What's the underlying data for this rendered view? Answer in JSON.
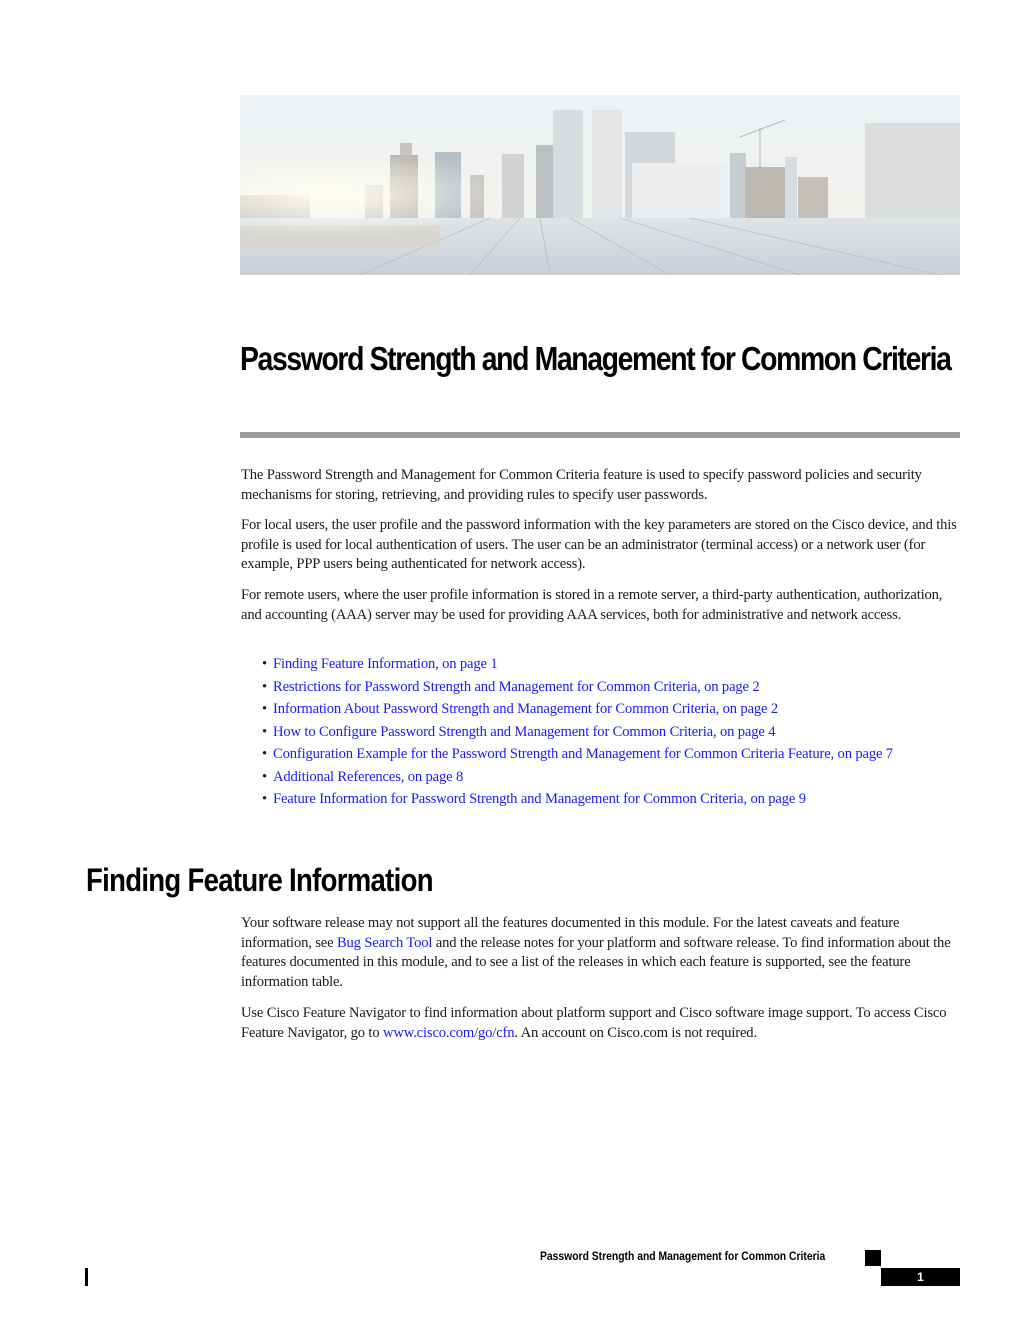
{
  "banner": {
    "description": "city skyline photo over reflective bridge deck"
  },
  "title": "Password Strength and Management for Common Criteria",
  "intro_paragraphs": [
    "The Password Strength and Management for Common Criteria feature is used to specify password policies and security mechanisms for storing, retrieving, and providing rules to specify user passwords.",
    "For local users, the user profile and the password information with the key parameters are stored on the Cisco device, and this profile is used for local authentication of users. The user can be an administrator (terminal access) or a network user (for example, PPP users being authenticated for network access).",
    "For remote users, where the user profile information is stored in a remote server, a third-party authentication, authorization, and accounting (AAA) server may be used for providing AAA services, both for administrative and network access."
  ],
  "toc": [
    {
      "label": "Finding Feature Information, on page 1"
    },
    {
      "label": "Restrictions for Password Strength and Management for Common Criteria, on page 2"
    },
    {
      "label": "Information About Password Strength and Management for Common Criteria, on page 2"
    },
    {
      "label": "How to Configure Password Strength and Management for Common Criteria, on page 4"
    },
    {
      "label": "Configuration Example for the Password Strength and Management for Common Criteria Feature, on page 7"
    },
    {
      "label": "Additional References, on page 8"
    },
    {
      "label": "Feature Information for Password Strength and Management for Common Criteria, on page 9"
    }
  ],
  "bullet_char": "•",
  "section": {
    "heading": "Finding Feature Information",
    "p1_before": "Your software release may not support all the features documented in this module. For the latest caveats and feature information, see ",
    "p1_link": "Bug Search Tool",
    "p1_after": " and the release notes for your platform and software release. To find information about the features documented in this module, and to see a list of the releases in which each feature is supported, see the feature information table.",
    "p2_before": "Use Cisco Feature Navigator to find information about platform support and Cisco software image support. To access Cisco Feature Navigator, go to ",
    "p2_link": "www.cisco.com/go/cfn",
    "p2_after": ". An account on Cisco.com is not required."
  },
  "footer": {
    "title": "Password Strength and Management for Common Criteria",
    "page_number": "1"
  },
  "colors": {
    "link": "#1a1aff",
    "rule": "#9b9b9b",
    "text": "#1a1a1a"
  }
}
